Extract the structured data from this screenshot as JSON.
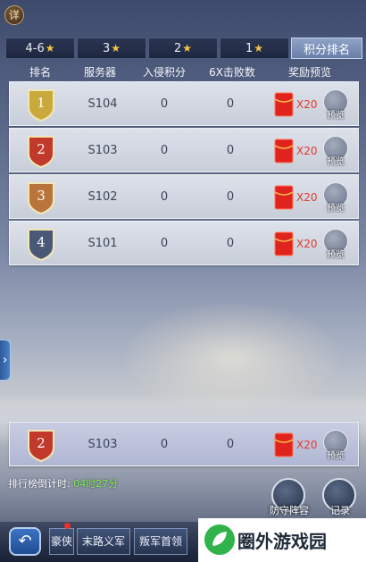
{
  "detail_label": "详",
  "tabs": [
    {
      "label": "4-6",
      "star": "★",
      "active": false
    },
    {
      "label": "3",
      "star": "★",
      "active": false
    },
    {
      "label": "2",
      "star": "★",
      "active": false
    },
    {
      "label": "1",
      "star": "★",
      "active": false
    },
    {
      "label": "积分排名",
      "star": "",
      "active": true
    }
  ],
  "columns": {
    "rank": "排名",
    "server": "服务器",
    "invasion_score": "入侵积分",
    "defeats": "6X击败数",
    "reward": "奖励预览"
  },
  "rows": [
    {
      "rank": "1",
      "server": "S104",
      "invasion_score": "0",
      "defeats": "0",
      "reward_count": "X20",
      "preview": "预览",
      "badge_color": "#c9a93c"
    },
    {
      "rank": "2",
      "server": "S103",
      "invasion_score": "0",
      "defeats": "0",
      "reward_count": "X20",
      "preview": "预览",
      "badge_color": "#c0392b"
    },
    {
      "rank": "3",
      "server": "S102",
      "invasion_score": "0",
      "defeats": "0",
      "reward_count": "X20",
      "preview": "预览",
      "badge_color": "#b8743a"
    },
    {
      "rank": "4",
      "server": "S101",
      "invasion_score": "0",
      "defeats": "0",
      "reward_count": "X20",
      "preview": "预览",
      "badge_color": "#4a5878"
    }
  ],
  "my_row": {
    "rank": "2",
    "server": "S103",
    "invasion_score": "0",
    "defeats": "0",
    "reward_count": "X20",
    "preview": "预览",
    "badge_color": "#c0392b"
  },
  "countdown": {
    "label": "排行榜倒计时: ",
    "time": "04时27分"
  },
  "buttons": {
    "defense_lineup": "防守阵容",
    "records": "记录"
  },
  "bottom_tabs": [
    "豪侠",
    "末路义军",
    "叛军首领"
  ],
  "watermark": "圈外游戏园"
}
